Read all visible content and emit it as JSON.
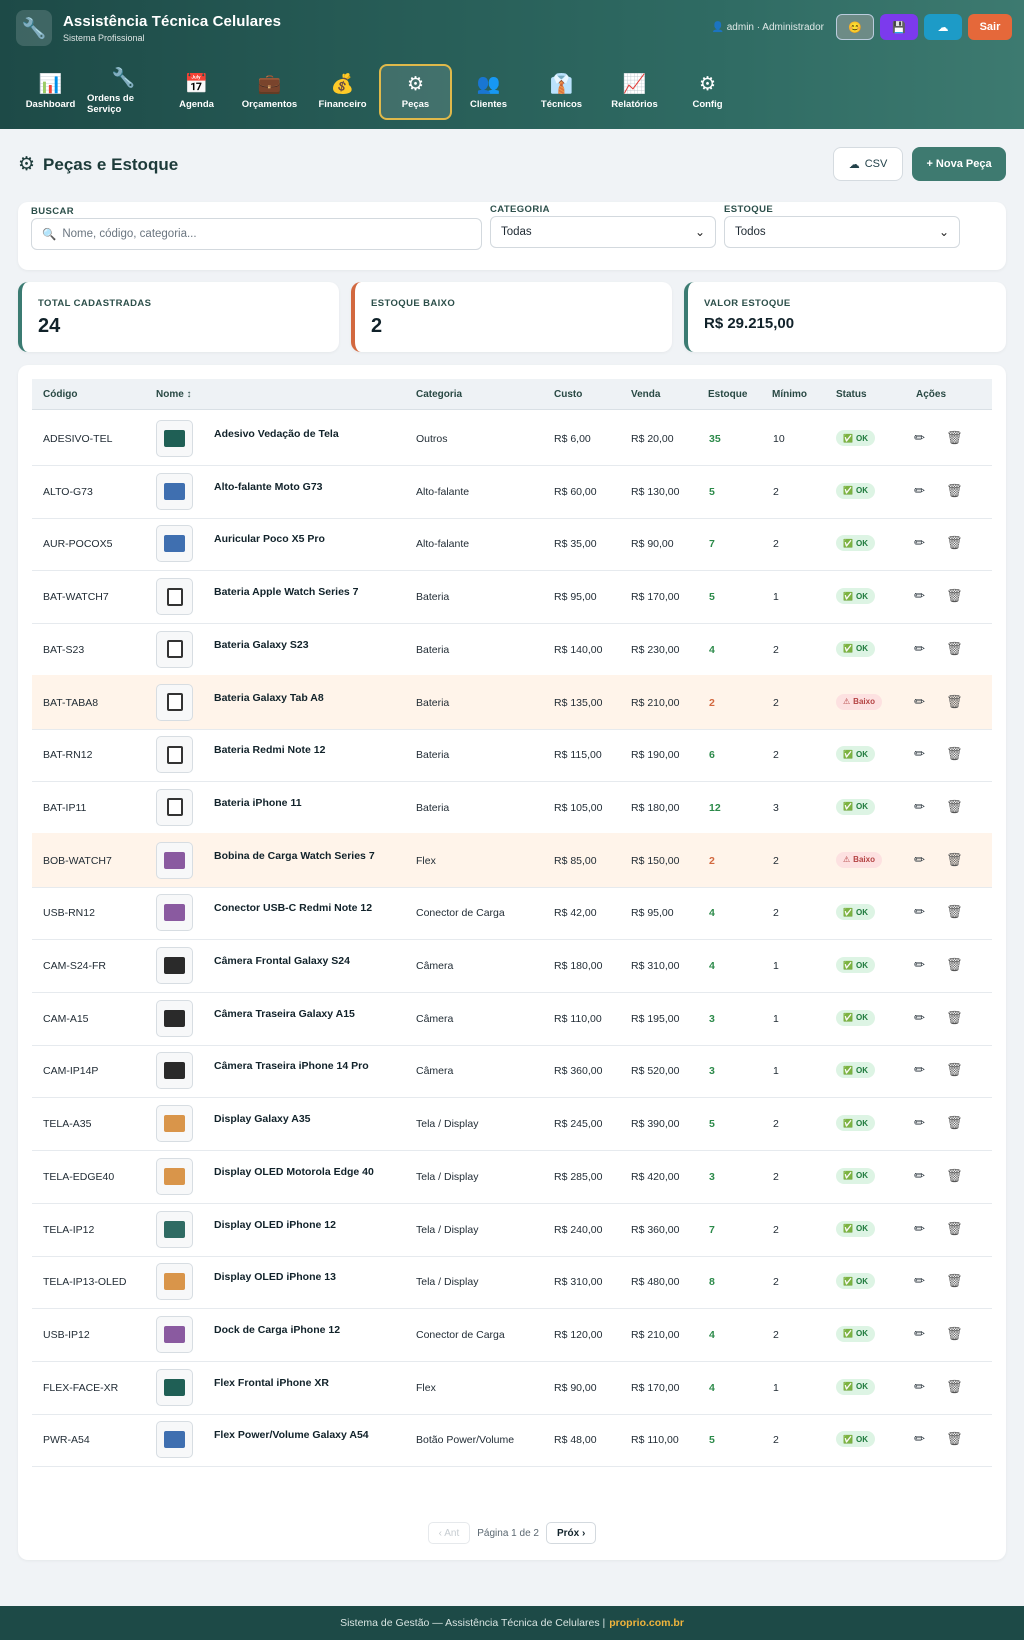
{
  "app": {
    "title": "Assistência Técnica Celulares",
    "subtitle": "Sistema Profissional"
  },
  "user": {
    "label": "admin · Administrador"
  },
  "header_buttons": [
    {
      "icon": "😊"
    },
    {
      "icon": "💾"
    },
    {
      "icon": "☁"
    }
  ],
  "logout_label": "Sair",
  "nav": [
    {
      "label": "Dashboard",
      "icon": "📊"
    },
    {
      "label": "Ordens de Serviço",
      "icon": "🔧"
    },
    {
      "label": "Agenda",
      "icon": "📅"
    },
    {
      "label": "Orçamentos",
      "icon": "💼"
    },
    {
      "label": "Financeiro",
      "icon": "💰"
    },
    {
      "label": "Peças",
      "icon": "⚙"
    },
    {
      "label": "Clientes",
      "icon": "👥"
    },
    {
      "label": "Técnicos",
      "icon": "👔"
    },
    {
      "label": "Relatórios",
      "icon": "📈"
    },
    {
      "label": "Config",
      "icon": "⚙"
    }
  ],
  "page": {
    "title": "Peças e Estoque",
    "csv_label": "CSV",
    "new_label": "+ Nova Peça"
  },
  "filters": {
    "search_label": "BUSCAR",
    "search_placeholder": "Nome, código, categoria...",
    "category_label": "CATEGORIA",
    "category_value": "Todas",
    "stock_label": "ESTOQUE",
    "stock_value": "Todos"
  },
  "stats": [
    {
      "label": "TOTAL CADASTRADAS",
      "value": "24"
    },
    {
      "label": "ESTOQUE BAIXO",
      "value": "2"
    },
    {
      "label": "VALOR ESTOQUE",
      "value": "R$ 29.215,00"
    }
  ],
  "table": {
    "headers": [
      "Código",
      "Nome ↕",
      "Categoria",
      "Custo",
      "Venda",
      "Estoque",
      "Mínimo",
      "Status",
      "Ações"
    ],
    "rows": [
      {
        "code": "ADESIVO-TEL",
        "name": "Adesivo Vedação de Tela",
        "cat": "Outros",
        "cost": "R$ 6,00",
        "price": "R$ 20,00",
        "stock": "35",
        "min": "10",
        "status": "OK",
        "color": "#1f5f55"
      },
      {
        "code": "ALTO-G73",
        "name": "Alto-falante Moto G73",
        "cat": "Alto-falante",
        "cost": "R$ 60,00",
        "price": "R$ 130,00",
        "stock": "5",
        "min": "2",
        "status": "OK",
        "color": "#3f6fb0"
      },
      {
        "code": "AUR-POCOX5",
        "name": "Auricular Poco X5 Pro",
        "cat": "Alto-falante",
        "cost": "R$ 35,00",
        "price": "R$ 90,00",
        "stock": "7",
        "min": "2",
        "status": "OK",
        "color": "#3f6fb0"
      },
      {
        "code": "BAT-WATCH7",
        "name": "Bateria Apple Watch Series 7",
        "cat": "Bateria",
        "cost": "R$ 95,00",
        "price": "R$ 170,00",
        "stock": "5",
        "min": "1",
        "status": "OK",
        "color": "#ffffff"
      },
      {
        "code": "BAT-S23",
        "name": "Bateria Galaxy S23",
        "cat": "Bateria",
        "cost": "R$ 140,00",
        "price": "R$ 230,00",
        "stock": "4",
        "min": "2",
        "status": "OK",
        "color": "#ffffff"
      },
      {
        "code": "BAT-TABA8",
        "name": "Bateria Galaxy Tab A8",
        "cat": "Bateria",
        "cost": "R$ 135,00",
        "price": "R$ 210,00",
        "stock": "2",
        "min": "2",
        "status": "Baixo",
        "color": "#ffffff"
      },
      {
        "code": "BAT-RN12",
        "name": "Bateria Redmi Note 12",
        "cat": "Bateria",
        "cost": "R$ 115,00",
        "price": "R$ 190,00",
        "stock": "6",
        "min": "2",
        "status": "OK",
        "color": "#ffffff"
      },
      {
        "code": "BAT-IP11",
        "name": "Bateria iPhone 11",
        "cat": "Bateria",
        "cost": "R$ 105,00",
        "price": "R$ 180,00",
        "stock": "12",
        "min": "3",
        "status": "OK",
        "color": "#ffffff"
      },
      {
        "code": "BOB-WATCH7",
        "name": "Bobina de Carga Watch Series 7",
        "cat": "Flex",
        "cost": "R$ 85,00",
        "price": "R$ 150,00",
        "stock": "2",
        "min": "2",
        "status": "Baixo",
        "color": "#8a5aa0"
      },
      {
        "code": "USB-RN12",
        "name": "Conector USB-C Redmi Note 12",
        "cat": "Conector de Carga",
        "cost": "R$ 42,00",
        "price": "R$ 95,00",
        "stock": "4",
        "min": "2",
        "status": "OK",
        "color": "#8a5aa0"
      },
      {
        "code": "CAM-S24-FR",
        "name": "Câmera Frontal Galaxy S24",
        "cat": "Câmera",
        "cost": "R$ 180,00",
        "price": "R$ 310,00",
        "stock": "4",
        "min": "1",
        "status": "OK",
        "color": "#2a2a2a"
      },
      {
        "code": "CAM-A15",
        "name": "Câmera Traseira Galaxy A15",
        "cat": "Câmera",
        "cost": "R$ 110,00",
        "price": "R$ 195,00",
        "stock": "3",
        "min": "1",
        "status": "OK",
        "color": "#2a2a2a"
      },
      {
        "code": "CAM-IP14P",
        "name": "Câmera Traseira iPhone 14 Pro",
        "cat": "Câmera",
        "cost": "R$ 360,00",
        "price": "R$ 520,00",
        "stock": "3",
        "min": "1",
        "status": "OK",
        "color": "#2a2a2a"
      },
      {
        "code": "TELA-A35",
        "name": "Display Galaxy A35",
        "cat": "Tela / Display",
        "cost": "R$ 245,00",
        "price": "R$ 390,00",
        "stock": "5",
        "min": "2",
        "status": "OK",
        "color": "#d9954a"
      },
      {
        "code": "TELA-EDGE40",
        "name": "Display OLED Motorola Edge 40",
        "cat": "Tela / Display",
        "cost": "R$ 285,00",
        "price": "R$ 420,00",
        "stock": "3",
        "min": "2",
        "status": "OK",
        "color": "#d9954a"
      },
      {
        "code": "TELA-IP12",
        "name": "Display OLED iPhone 12",
        "cat": "Tela / Display",
        "cost": "R$ 240,00",
        "price": "R$ 360,00",
        "stock": "7",
        "min": "2",
        "status": "OK",
        "color": "#2f6b63"
      },
      {
        "code": "TELA-IP13-OLED",
        "name": "Display OLED iPhone 13",
        "cat": "Tela / Display",
        "cost": "R$ 310,00",
        "price": "R$ 480,00",
        "stock": "8",
        "min": "2",
        "status": "OK",
        "color": "#d9954a"
      },
      {
        "code": "USB-IP12",
        "name": "Dock de Carga iPhone 12",
        "cat": "Conector de Carga",
        "cost": "R$ 120,00",
        "price": "R$ 210,00",
        "stock": "4",
        "min": "2",
        "status": "OK",
        "color": "#8a5aa0"
      },
      {
        "code": "FLEX-FACE-XR",
        "name": "Flex Frontal iPhone XR",
        "cat": "Flex",
        "cost": "R$ 90,00",
        "price": "R$ 170,00",
        "stock": "4",
        "min": "1",
        "status": "OK",
        "color": "#1f5f55"
      },
      {
        "code": "PWR-A54",
        "name": "Flex Power/Volume Galaxy A54",
        "cat": "Botão Power/Volume",
        "cost": "R$ 48,00",
        "price": "R$ 110,00",
        "stock": "5",
        "min": "2",
        "status": "OK",
        "color": "#3f6fb0"
      }
    ]
  },
  "pager": {
    "prev": "‹ Ant",
    "info": "Página 1 de 2",
    "next": "Próx ›"
  },
  "footer": {
    "text": "Sistema de Gestão — Assistência Técnica de Celulares  |",
    "link": "proprio.com.br"
  }
}
